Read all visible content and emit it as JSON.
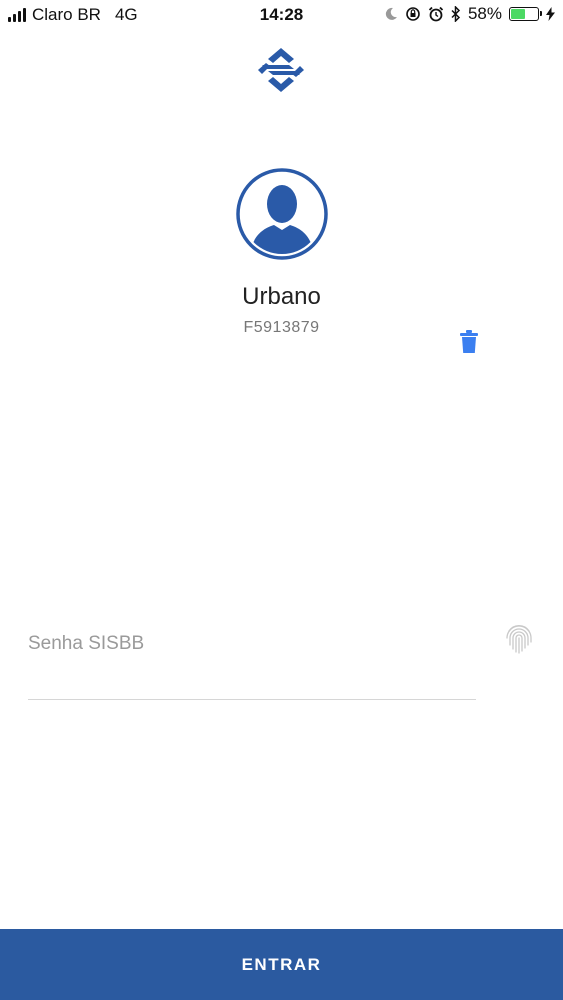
{
  "status_bar": {
    "carrier": "Claro BR",
    "network": "4G",
    "time": "14:28",
    "battery_percent": "58%",
    "battery_level": 0.58
  },
  "colors": {
    "brand_blue": "#2b5aa0",
    "avatar_blue": "#2a5aa8",
    "trash_blue": "#3b7ff0",
    "battery_green": "#4cd964"
  },
  "icons": {
    "logo": "banco-do-brasil-logo",
    "avatar": "user-silhouette-icon",
    "delete": "trash-icon",
    "biometric": "fingerprint-icon"
  },
  "user": {
    "name": "Urbano",
    "id": "F5913879"
  },
  "login": {
    "password_placeholder": "Senha SISBB",
    "password_value": "",
    "submit_label": "ENTRAR"
  }
}
